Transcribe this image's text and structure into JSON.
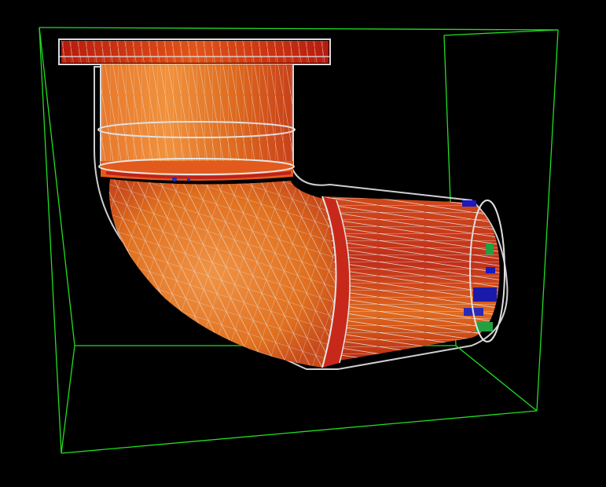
{
  "viewer": {
    "background_color": "#000000",
    "bounding_box_color": "#22dd22",
    "wireframe_color": "#d8d8d8"
  },
  "model": {
    "object": "pipe-elbow-mesh",
    "surface_palette": [
      "#e0701a",
      "#f08a3a",
      "#c8361a",
      "#b01c10",
      "#2020c0",
      "#20a040"
    ]
  }
}
